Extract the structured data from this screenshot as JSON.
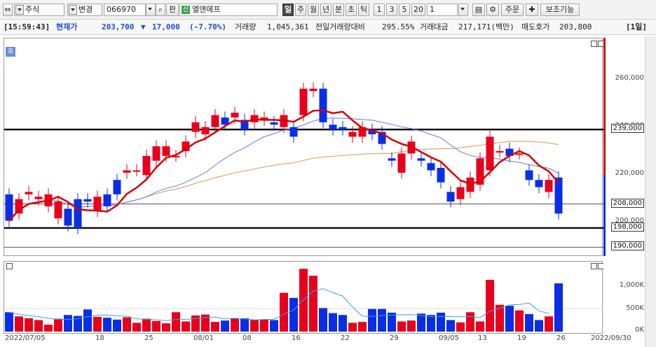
{
  "toolbar": {
    "market_type": "주식",
    "change_label": "변경",
    "stock_code": "066970",
    "chart_label": "판",
    "stock_mark": "신",
    "stock_name": "엘앤에프",
    "periods": [
      "일",
      "주",
      "월",
      "년",
      "분",
      "초",
      "틱"
    ],
    "selected_period": "일",
    "intervals": [
      "1",
      "3",
      "5",
      "20"
    ],
    "interval_value": "1",
    "order_label": "주문",
    "aux_label": "보조기능"
  },
  "quote": {
    "time": "[15:59:43]",
    "current_label": "현재가",
    "current_price": "203,700",
    "change_arrow": "▼",
    "change": "17,000",
    "change_pct": "(-7.70%)",
    "volume_label": "거래량",
    "volume": "1,045,361",
    "prev_vol_label": "전일거래량대비",
    "prev_vol_ratio": "295.55%",
    "amount_label": "거래대금",
    "amount": "217,171(백만)",
    "ask_label": "매도호가",
    "ask": "203,800",
    "period_tag": "[1일]"
  },
  "price_axis": {
    "labels": [
      "260,000",
      "240,000",
      "220,000",
      "200,000"
    ],
    "boxed": [
      "239,000",
      "208,000",
      "198,000",
      "190,000"
    ],
    "side_tab": "호"
  },
  "volume_axis": {
    "labels": [
      "1,000K",
      "500K",
      "0K"
    ]
  },
  "x_axis": {
    "labels": [
      "2022/07/05",
      "18",
      "25",
      "08/01",
      "08",
      "16",
      "22",
      "29",
      "09/05",
      "13",
      "19",
      "26",
      "2022/09/30"
    ]
  },
  "colors": {
    "up": "#e8001c",
    "down": "#0a2ee6",
    "ma5": "#d40000",
    "ma20": "#6a79e8",
    "ma60": "#d49a4c",
    "vol_line": "#3aa0e6"
  },
  "chart_data": [
    {
      "type": "candlestick",
      "x": [
        "07/05",
        "07/06",
        "07/07",
        "07/08",
        "07/11",
        "07/12",
        "07/13",
        "07/14",
        "07/15",
        "07/18",
        "07/19",
        "07/20",
        "07/21",
        "07/22",
        "07/25",
        "07/26",
        "07/27",
        "07/28",
        "07/29",
        "08/01",
        "08/02",
        "08/03",
        "08/04",
        "08/05",
        "08/08",
        "08/09",
        "08/10",
        "08/11",
        "08/12",
        "08/16",
        "08/17",
        "08/18",
        "08/19",
        "08/22",
        "08/23",
        "08/24",
        "08/25",
        "08/26",
        "08/29",
        "08/30",
        "08/31",
        "09/01",
        "09/02",
        "09/05",
        "09/06",
        "09/07",
        "09/08",
        "09/13",
        "09/14",
        "09/15",
        "09/16",
        "09/19",
        "09/20",
        "09/21",
        "09/22",
        "09/23",
        "09/26"
      ],
      "open": [
        212000,
        204000,
        212000,
        210000,
        207000,
        202000,
        206000,
        210000,
        210000,
        205000,
        212000,
        218000,
        221000,
        222000,
        220000,
        226000,
        228000,
        228000,
        230000,
        238000,
        237000,
        240000,
        244000,
        244000,
        243000,
        242000,
        243000,
        242000,
        240000,
        240000,
        245000,
        255000,
        256000,
        241000,
        240000,
        236000,
        236000,
        239000,
        238000,
        227000,
        221000,
        229000,
        227000,
        225000,
        223000,
        213000,
        210000,
        213000,
        216000,
        222000,
        230000,
        231000,
        229000,
        222000,
        218000,
        213000,
        219000
      ],
      "close": [
        201000,
        210000,
        213000,
        211000,
        212000,
        209000,
        199000,
        198000,
        209000,
        211000,
        207000,
        212000,
        222000,
        222000,
        228000,
        232000,
        232000,
        228000,
        234000,
        242000,
        240000,
        245000,
        241000,
        246000,
        239000,
        245000,
        244000,
        241000,
        245000,
        236000,
        256000,
        256000,
        242000,
        239000,
        239000,
        238000,
        240000,
        237000,
        233000,
        226000,
        229000,
        234000,
        226000,
        222000,
        217000,
        209000,
        215000,
        219000,
        227000,
        236000,
        230000,
        228000,
        229000,
        218000,
        215000,
        218000,
        204000
      ],
      "ylim": [
        190000,
        265000
      ]
    },
    {
      "type": "bar",
      "series": [
        {
          "values": [
            420,
            330,
            290,
            250,
            150,
            280,
            360,
            340,
            480,
            320,
            300,
            260,
            310,
            190,
            280,
            230,
            180,
            420,
            220,
            350,
            370,
            210,
            240,
            280,
            290,
            250,
            260,
            250,
            840,
            730,
            1360,
            1210,
            510,
            400,
            360,
            190,
            210,
            490,
            490,
            410,
            220,
            240,
            390,
            360,
            410,
            250,
            200,
            420,
            220,
            1120,
            580,
            560,
            460,
            380,
            250,
            330,
            1045
          ]
        }
      ],
      "ylim": [
        0,
        1400
      ]
    }
  ]
}
